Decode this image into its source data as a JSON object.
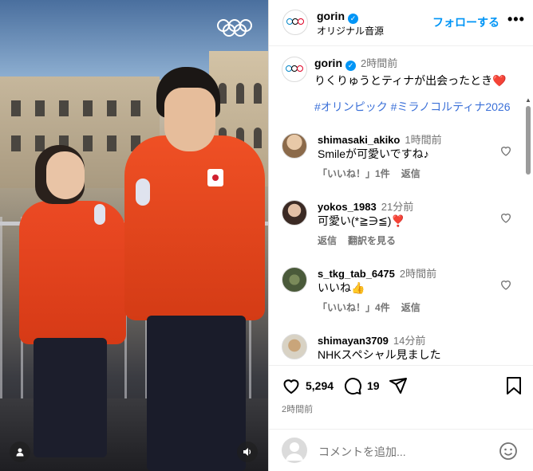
{
  "media": {
    "person_icon": "person-icon",
    "sound_icon": "speaker-icon",
    "logo": "olympic-rings"
  },
  "header": {
    "username": "gorin",
    "subtitle": "オリジナル音源",
    "follow_label": "フォローする",
    "more_label": "•••"
  },
  "caption": {
    "username": "gorin",
    "time": "2時間前",
    "text": "りくりゅうとティナが出会ったとき❤️",
    "hashtags": "#オリンピック #ミラノコルティナ2026"
  },
  "comments": [
    {
      "username": "shimasaki_akiko",
      "time": "1時間前",
      "text": "Smileが可愛いですね♪",
      "likes": "「いいね！」1件",
      "reply": "返信",
      "translate": ""
    },
    {
      "username": "yokos_1983",
      "time": "21分前",
      "text": "可愛い(*≧∋≦)❣️",
      "likes": "",
      "reply": "返信",
      "translate": "翻訳を見る"
    },
    {
      "username": "s_tkg_tab_6475",
      "time": "2時間前",
      "text": "いいね👍",
      "likes": "「いいね！」4件",
      "reply": "返信",
      "translate": ""
    },
    {
      "username": "shimayan3709",
      "time": "14分前",
      "text": "NHKスペシャル見ました",
      "likes": "",
      "reply": "",
      "translate": ""
    }
  ],
  "actions": {
    "likes_count": "5,294",
    "comments_count": "19"
  },
  "posted_time": "2時間前",
  "comment_input": {
    "placeholder": "コメントを追加..."
  },
  "colors": {
    "accent": "#0095f6",
    "hashtag": "#3b70d8",
    "muted": "#737373"
  }
}
